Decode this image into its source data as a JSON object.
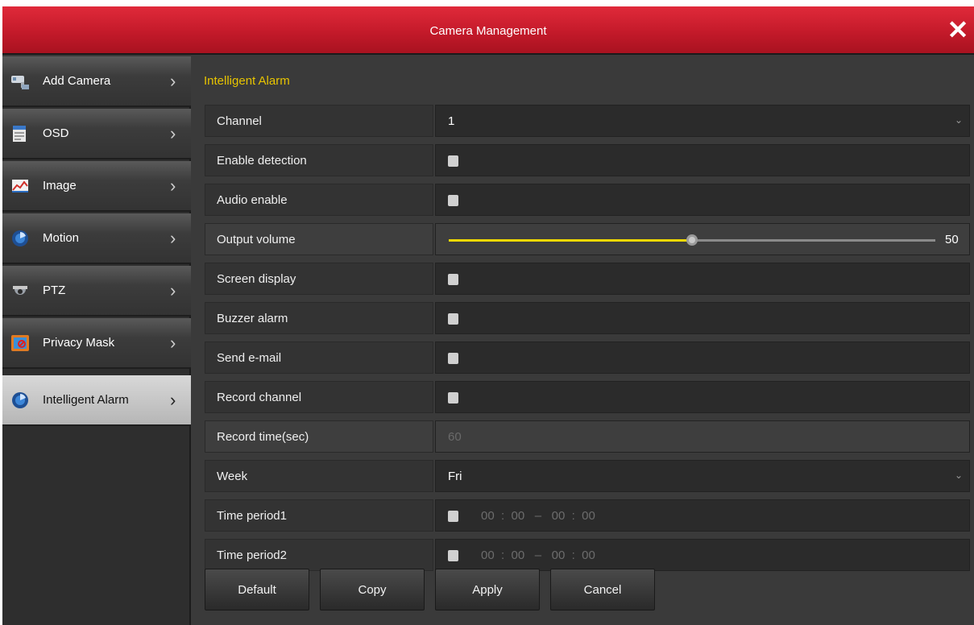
{
  "window": {
    "title": "Camera Management",
    "close_glyph": "✕"
  },
  "sidebar": {
    "items": [
      {
        "label": "Add Camera",
        "icon": "camera-icon"
      },
      {
        "label": "OSD",
        "icon": "osd-icon"
      },
      {
        "label": "Image",
        "icon": "image-icon"
      },
      {
        "label": "Motion",
        "icon": "motion-icon"
      },
      {
        "label": "PTZ",
        "icon": "ptz-camera-icon"
      },
      {
        "label": "Privacy Mask",
        "icon": "privacy-mask-icon"
      },
      {
        "label": "Intelligent Alarm",
        "icon": "intelligent-alarm-icon",
        "active": true
      }
    ]
  },
  "main": {
    "section_title": "Intelligent Alarm",
    "fields": {
      "channel": {
        "label": "Channel",
        "value": "1"
      },
      "enable_detection": {
        "label": "Enable detection",
        "checked": false
      },
      "audio_enable": {
        "label": "Audio enable",
        "checked": false
      },
      "output_volume": {
        "label": "Output volume",
        "value": "50",
        "fraction": 0.5
      },
      "screen_display": {
        "label": "Screen display",
        "checked": false
      },
      "buzzer_alarm": {
        "label": "Buzzer alarm",
        "checked": false
      },
      "send_email": {
        "label": "Send e-mail",
        "checked": false
      },
      "record_channel": {
        "label": "Record channel",
        "checked": false
      },
      "record_time": {
        "label": "Record time(sec)",
        "value": "60"
      },
      "week": {
        "label": "Week",
        "value": "Fri"
      },
      "time_period1": {
        "label": "Time period1",
        "start_h": "00",
        "start_m": "00",
        "end_h": "00",
        "end_m": "00"
      },
      "time_period2": {
        "label": "Time period2",
        "start_h": "00",
        "start_m": "00",
        "end_h": "00",
        "end_m": "00"
      }
    },
    "time_separator": ":",
    "time_dash": "–"
  },
  "buttons": {
    "default": "Default",
    "copy": "Copy",
    "apply": "Apply",
    "cancel": "Cancel"
  },
  "colors": {
    "titlebar": "#c41a2a",
    "accent": "#e8c400",
    "slider_fill": "#f0d800"
  }
}
